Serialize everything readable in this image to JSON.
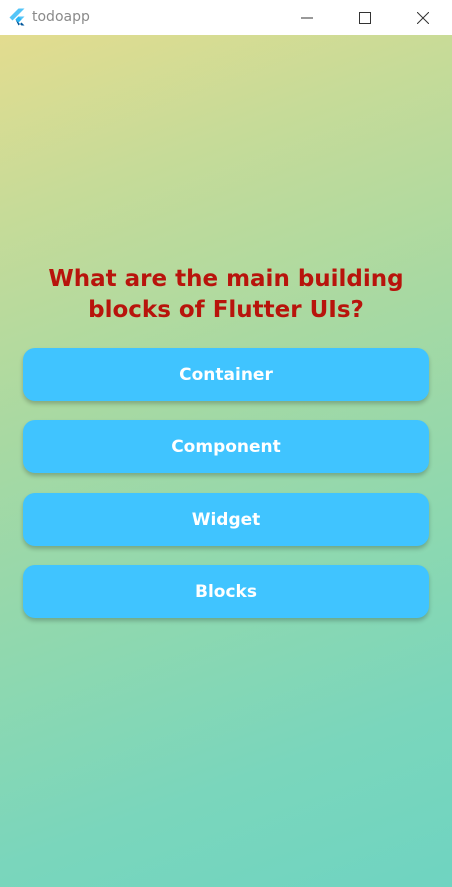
{
  "window": {
    "title": "todoapp",
    "app_icon": "flutter-logo-icon",
    "controls": [
      "minimize-icon",
      "maximize-icon",
      "close-icon"
    ]
  },
  "quiz": {
    "question": "What are the main building blocks of Flutter UIs?",
    "answers": [
      {
        "label": "Container"
      },
      {
        "label": "Component"
      },
      {
        "label": "Widget"
      },
      {
        "label": "Blocks"
      }
    ]
  },
  "colors": {
    "question_text": "#b8140c",
    "button_bg": "#40c4ff",
    "button_text": "#ffffff",
    "gradient_start": "#e3dc8f",
    "gradient_end": "#6fd4c1"
  }
}
